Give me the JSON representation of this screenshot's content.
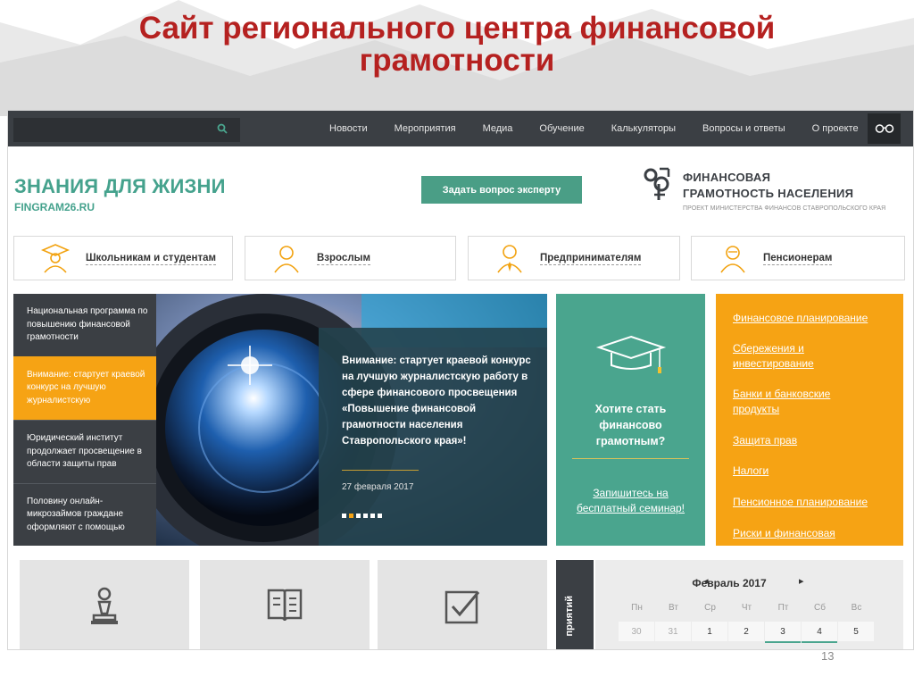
{
  "slide": {
    "title": "Сайт регионального центра финансовой грамотности",
    "number": "13"
  },
  "site": {
    "search": {
      "placeholder": ""
    },
    "nav": [
      "Новости",
      "Мероприятия",
      "Медиа",
      "Обучение",
      "Калькуляторы",
      "Вопросы и ответы",
      "О проекте"
    ],
    "logo": {
      "title": "ЗНАНИЯ ДЛЯ ЖИЗНИ",
      "url": "FINGRAM26.RU"
    },
    "ask_button": "Задать вопрос эксперту",
    "brand": {
      "name_line1": "ФИНАНСОВАЯ",
      "name_line2": "ГРАМОТНОСТЬ НАСЕЛЕНИЯ",
      "subtitle": "ПРОЕКТ МИНИСТЕРСТВА ФИНАНСОВ СТАВРОПОЛЬСКОГО КРАЯ"
    },
    "audiences": [
      "Школьникам и студентам",
      "Взрослым",
      "Предпринимателям",
      "Пенсионерам"
    ],
    "news": [
      "Национальная программа по повышению финансовой грамотности",
      "Внимание: стартует краевой конкурс на лучшую журналистскую",
      "Юридический институт продолжает просвещение в области защиты прав",
      "Половину онлайн-микрозаймов граждане оформляют с помощью"
    ],
    "hero": {
      "text": "Внимание: стартует краевой конкурс на лучшую журналистскую работу в сфере финансового просвещения «Повышение финансовой грамотности населения Ставропольского края»!",
      "date": "27 февраля 2017"
    },
    "cta": {
      "title": "Хотите стать финансово грамотным?",
      "link": "Запишитесь на бесплатный семинар!"
    },
    "topics": [
      "Финансовое планирование",
      "Сбережения и инвестирование",
      "Банки и банковские продукты",
      "Защита прав",
      "Налоги",
      "Пенсионное планирование",
      "Риски и финансовая"
    ],
    "events_label": "приятий",
    "calendar": {
      "month": "Февраль 2017",
      "weekdays": [
        "Пн",
        "Вт",
        "Ср",
        "Чт",
        "Пт",
        "Сб",
        "Вс"
      ],
      "dates": [
        "30",
        "31",
        "1",
        "2",
        "3",
        "4",
        "5"
      ]
    }
  },
  "colors": {
    "title_red": "#b52120",
    "teal": "#4aa58e",
    "orange": "#f6a314",
    "dark": "#3b3f44",
    "news_highlight": "#f6a314"
  }
}
